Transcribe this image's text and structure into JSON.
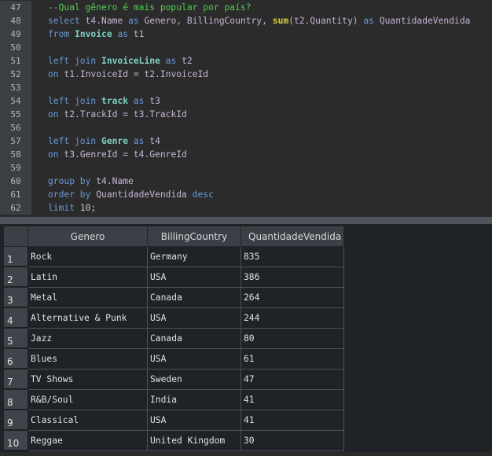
{
  "editor": {
    "line_numbers": [
      "47",
      "48",
      "49",
      "50",
      "51",
      "52",
      "53",
      "54",
      "55",
      "56",
      "57",
      "58",
      "59",
      "60",
      "61",
      "62"
    ],
    "tokens": {
      "l47_comment": "--Qual gênero é mais popular por país?",
      "l48_select": "select",
      "l48_t4name": "t4.Name",
      "l48_as1": "as",
      "l48_genero": "Genero,",
      "l48_billing": "BillingCountry,",
      "l48_sum": "sum",
      "l48_arg": "(t2.Quantity)",
      "l48_as2": "as",
      "l48_alias": "QuantidadeVendida",
      "l49_from": "from",
      "l49_table": "Invoice",
      "l49_as": "as",
      "l49_alias": "t1",
      "l51_left": "left join",
      "l51_table": "InvoiceLine",
      "l51_as": "as",
      "l51_alias": "t2",
      "l52_on": "on",
      "l52_cond": "t1.InvoiceId = t2.InvoiceId",
      "l54_left": "left join",
      "l54_table": "track",
      "l54_as": "as",
      "l54_alias": "t3",
      "l55_on": "on",
      "l55_cond": "t2.TrackId = t3.TrackId",
      "l57_left": "left join",
      "l57_table": "Genre",
      "l57_as": "as",
      "l57_alias": "t4",
      "l58_on": "on",
      "l58_cond": "t3.GenreId = t4.GenreId",
      "l60_group": "group by",
      "l60_field": "t4.Name",
      "l61_order": "order by",
      "l61_field": "QuantidadeVendida",
      "l61_desc": "desc",
      "l62_limit": "limit",
      "l62_value": "10;"
    }
  },
  "results": {
    "columns": [
      "Genero",
      "BillingCountry",
      "QuantidadeVendida"
    ],
    "rows": [
      {
        "num": "1",
        "genero": "Rock",
        "country": "Germany",
        "qty": "835"
      },
      {
        "num": "2",
        "genero": "Latin",
        "country": "USA",
        "qty": "386"
      },
      {
        "num": "3",
        "genero": "Metal",
        "country": "Canada",
        "qty": "264"
      },
      {
        "num": "4",
        "genero": "Alternative & Punk",
        "country": "USA",
        "qty": "244"
      },
      {
        "num": "5",
        "genero": "Jazz",
        "country": "Canada",
        "qty": "80"
      },
      {
        "num": "6",
        "genero": "Blues",
        "country": "USA",
        "qty": "61"
      },
      {
        "num": "7",
        "genero": "TV Shows",
        "country": "Sweden",
        "qty": "47"
      },
      {
        "num": "8",
        "genero": "R&B/Soul",
        "country": "India",
        "qty": "41"
      },
      {
        "num": "9",
        "genero": "Classical",
        "country": "USA",
        "qty": "41"
      },
      {
        "num": "10",
        "genero": "Reggae",
        "country": "United Kingdom",
        "qty": "30"
      }
    ]
  }
}
